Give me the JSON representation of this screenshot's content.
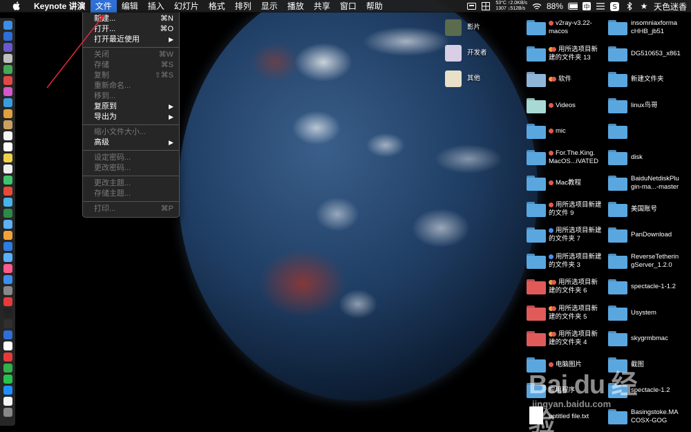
{
  "menubar": {
    "items": [
      "Keynote 讲演",
      "文件",
      "编辑",
      "插入",
      "幻灯片",
      "格式",
      "排列",
      "显示",
      "播放",
      "共享",
      "窗口",
      "帮助"
    ],
    "active_index": 1,
    "status": {
      "temp": "53°C ↑2.0KB/s",
      "fan": "1307 ↓512B/s",
      "battery": "88%",
      "input_method": "中",
      "user": "天色迷香"
    }
  },
  "file_menu": {
    "items": [
      {
        "label": "新建...",
        "shortcut": "⌘N",
        "enabled": true
      },
      {
        "label": "打开...",
        "shortcut": "⌘O",
        "enabled": true
      },
      {
        "label": "打开最近使用",
        "shortcut": "▶",
        "enabled": true
      },
      {
        "sep": true
      },
      {
        "label": "关闭",
        "shortcut": "⌘W",
        "enabled": false
      },
      {
        "label": "存储",
        "shortcut": "⌘S",
        "enabled": false
      },
      {
        "label": "复制",
        "shortcut": "⇧⌘S",
        "enabled": false
      },
      {
        "label": "重新命名...",
        "shortcut": "",
        "enabled": false
      },
      {
        "label": "移到...",
        "shortcut": "",
        "enabled": false
      },
      {
        "label": "复原到",
        "shortcut": "▶",
        "enabled": true
      },
      {
        "label": "导出为",
        "shortcut": "▶",
        "enabled": true
      },
      {
        "sep": true
      },
      {
        "label": "缩小文件大小...",
        "shortcut": "",
        "enabled": false
      },
      {
        "label": "高级",
        "shortcut": "▶",
        "enabled": true
      },
      {
        "sep": true
      },
      {
        "label": "设定密码...",
        "shortcut": "",
        "enabled": false
      },
      {
        "label": "更改密码...",
        "shortcut": "",
        "enabled": false
      },
      {
        "sep": true
      },
      {
        "label": "更改主题...",
        "shortcut": "",
        "enabled": false
      },
      {
        "label": "存储主题...",
        "shortcut": "",
        "enabled": false
      },
      {
        "sep": true
      },
      {
        "label": "打印...",
        "shortcut": "⌘P",
        "enabled": false
      }
    ]
  },
  "desktop": {
    "col1": [
      {
        "label": "影片",
        "kind": "thumb",
        "color": "#5b6b4e"
      },
      {
        "label": "开发者",
        "kind": "thumb",
        "color": "#d8cfe6"
      },
      {
        "label": "其他",
        "kind": "thumb",
        "color": "#e8e0c8"
      }
    ],
    "col2": [
      {
        "label": "v2ray-v3.22-\nmacos",
        "tags": [
          "#e05a4f"
        ],
        "color": "#5aa7e0"
      },
      {
        "label": "用所选项目新\n建的文件夹 13",
        "tags": [
          "#f2a23a",
          "#e05a4f"
        ],
        "color": "#5aa7e0"
      },
      {
        "label": "软件",
        "tags": [
          "#f2a23a",
          "#e05a4f"
        ],
        "color": "#8fb5d8"
      },
      {
        "label": "Videos",
        "tags": [
          "#e05a4f"
        ],
        "color": "#a9d9d4"
      },
      {
        "label": "mic",
        "tags": [
          "#e05a4f"
        ],
        "color": "#5aa7e0"
      },
      {
        "label": "For.The.King.\nMacOS...iVATED",
        "tags": [
          "#e05a4f"
        ],
        "color": "#5aa7e0"
      },
      {
        "label": "Mac教程",
        "tags": [
          "#e05a4f"
        ],
        "color": "#5aa7e0"
      },
      {
        "label": "用所选项目新建\n的文件 9",
        "tags": [
          "#e05a4f"
        ],
        "color": "#5aa7e0"
      },
      {
        "label": "用所选项目新建\n的文件夹 7",
        "tags": [
          "#4a8ef0"
        ],
        "color": "#5aa7e0"
      },
      {
        "label": "用所选项目新建\n的文件夹 3",
        "tags": [
          "#4a8ef0"
        ],
        "color": "#5aa7e0"
      },
      {
        "label": "用所选项目新\n建的文件夹 6",
        "tags": [
          "#f2a23a",
          "#e05a4f"
        ],
        "color": "#e05a5a"
      },
      {
        "label": "用所选项目新\n建的文件夹 5",
        "tags": [
          "#f2a23a",
          "#e05a4f"
        ],
        "color": "#e05a5a"
      },
      {
        "label": "用所选项目新\n建的文件夹 4",
        "tags": [
          "#f2a23a",
          "#e05a4f"
        ],
        "color": "#e05a5a"
      },
      {
        "label": "电脑图片",
        "tags": [
          "#e05a4f"
        ],
        "color": "#5aa7e0"
      },
      {
        "label": "应用程序",
        "tags": [],
        "color": "#5aa7e0"
      },
      {
        "label": "untitled file.txt",
        "tags": [],
        "color": "#ffffff",
        "file": true
      }
    ],
    "col3": [
      {
        "label": "insomniaxforma\ncHHB_jb51",
        "color": "#5aa7e0"
      },
      {
        "label": "DG510653_x861",
        "color": "#5aa7e0"
      },
      {
        "label": "新建文件夹",
        "color": "#5aa7e0"
      },
      {
        "label": "linux鸟哥",
        "color": "#5aa7e0"
      },
      {
        "label": "",
        "color": "#5aa7e0"
      },
      {
        "label": "disk",
        "color": "#5aa7e0"
      },
      {
        "label": "BaiduNetdiskPlu\ngin-ma...-master",
        "color": "#5aa7e0"
      },
      {
        "label": "美国账号",
        "color": "#5aa7e0"
      },
      {
        "label": "PanDownload",
        "color": "#5aa7e0"
      },
      {
        "label": "ReverseTetherin\ngServer_1.2.0",
        "color": "#5aa7e0"
      },
      {
        "label": "spectacle-1-1.2",
        "color": "#5aa7e0"
      },
      {
        "label": "Usystem",
        "color": "#5aa7e0"
      },
      {
        "label": "skygrmbmac",
        "color": "#5aa7e0"
      },
      {
        "label": "截图",
        "color": "#5aa7e0"
      },
      {
        "label": "spectacle-1.2",
        "color": "#5aa7e0"
      },
      {
        "label": "Basingstoke.MA\nCOSX-GOG",
        "color": "#5aa7e0"
      }
    ]
  },
  "watermark": {
    "text": "Bai du 经验",
    "url": "jingyan.baidu.com"
  },
  "dock_colors": [
    "#3b8fe6",
    "#2d6fd6",
    "#6a5acd",
    "#c0c0c0",
    "#44aa55",
    "#e04848",
    "#d35ac8",
    "#3a9de0",
    "#e0a040",
    "#caa060",
    "#f5f5f5",
    "#ffffff",
    "#f0d24a",
    "#eeeeee",
    "#3ec56a",
    "#e64a3a",
    "#4ab3e8",
    "#2c8a4a",
    "#5fb0f5",
    "#f2a23a",
    "#2e7de0",
    "#5ab0ff",
    "#ff5a8c",
    "#3a8ff0",
    "#888888",
    "#e83a3a",
    "#222222",
    "#303030",
    "#2f6fd6",
    "#ffffff",
    "#e83a3a",
    "#2fb24a",
    "#27c24c",
    "#1e90ff",
    "#f5f5f5",
    "#888888"
  ]
}
